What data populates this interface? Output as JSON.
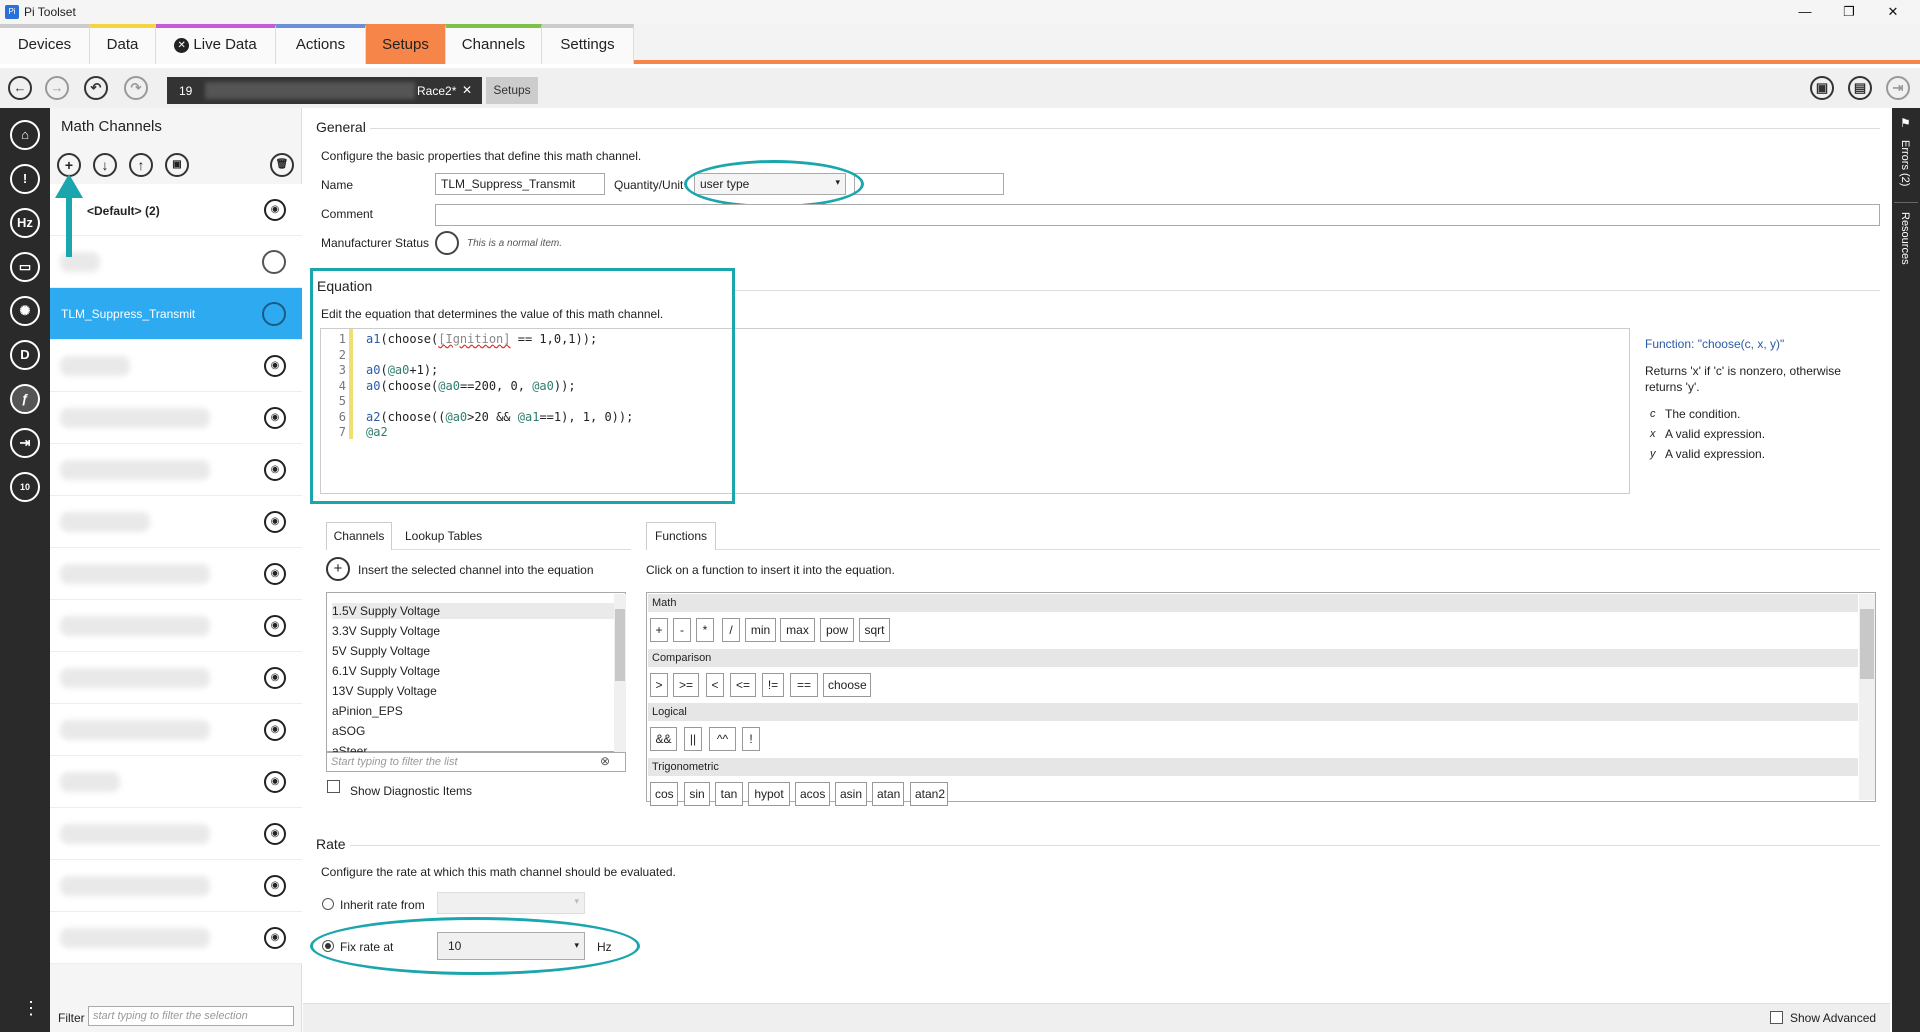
{
  "window": {
    "title": "Pi Toolset",
    "app_icon": "Pi",
    "minimize": "—",
    "maximize": "❐",
    "close": "✕"
  },
  "tabs": [
    {
      "label": "Devices",
      "color": "#cccccc"
    },
    {
      "label": "Data",
      "color": "#f5d442"
    },
    {
      "label": "Live Data",
      "color": "#c55bd8"
    },
    {
      "label": "Actions",
      "color": "#6a8fd8"
    },
    {
      "label": "Setups",
      "color": "#f58549"
    },
    {
      "label": "Channels",
      "color": "#7cc24a"
    },
    {
      "label": "Settings",
      "color": "#cccccc"
    }
  ],
  "live_data_icon": "close-circle-icon",
  "doc_tab": {
    "prefix": "19",
    "suffix": "Race2*",
    "close": "✕"
  },
  "setups_tab": "Setups",
  "list_panel": {
    "title": "Math Channels",
    "default_item": "<Default> (2)",
    "selected_item": "TLM_Suppress_Transmit",
    "filter_label": "Filter",
    "filter_placeholder": "start typing to filter the selection"
  },
  "general": {
    "title": "General",
    "description": "Configure the basic properties that define this math channel.",
    "name_label": "Name",
    "name_value": "TLM_Suppress_Transmit",
    "quantity_label": "Quantity/Unit",
    "quantity_value": "user type",
    "comment_label": "Comment",
    "manufacturer_label": "Manufacturer Status",
    "manufacturer_note": "This is a normal item."
  },
  "equation": {
    "title": "Equation",
    "description": "Edit the equation that determines the value of this math channel.",
    "line_numbers": [
      "1",
      "2",
      "3",
      "4",
      "5",
      "6",
      "7"
    ]
  },
  "help": {
    "title": "Function: \"choose(c, x, y)\"",
    "desc1": "Returns 'x' if 'c' is nonzero, otherwise",
    "desc2": "returns 'y'.",
    "params": [
      {
        "name": "c",
        "desc": "The condition."
      },
      {
        "name": "x",
        "desc": "A valid expression."
      },
      {
        "name": "y",
        "desc": "A valid expression."
      }
    ]
  },
  "channels_tabs": {
    "channels": "Channels",
    "lookup": "Lookup Tables",
    "functions": "Functions"
  },
  "insert_channel": "Insert the selected channel into the equation",
  "insert_function": "Click on a function to insert it into the equation.",
  "channel_list": [
    "1.5V Supply Voltage",
    "3.3V Supply Voltage",
    "5V Supply Voltage",
    "6.1V Supply Voltage",
    "13V Supply Voltage",
    "aPinion_EPS",
    "aSOG",
    "aSteer"
  ],
  "channel_filter_placeholder": "Start typing to filter the list",
  "show_diagnostic": "Show Diagnostic Items",
  "function_groups": {
    "math": {
      "label": "Math",
      "items": [
        "+",
        "-",
        "*",
        "/",
        "min",
        "max",
        "pow",
        "sqrt"
      ]
    },
    "comparison": {
      "label": "Comparison",
      "items": [
        ">",
        ">=",
        "<",
        "<=",
        "!=",
        "==",
        "choose"
      ]
    },
    "logical": {
      "label": "Logical",
      "items": [
        "&&",
        "||",
        "^^",
        "!"
      ]
    },
    "trig": {
      "label": "Trigonometric",
      "items": [
        "cos",
        "sin",
        "tan",
        "hypot",
        "acos",
        "asin",
        "atan",
        "atan2"
      ]
    }
  },
  "rate": {
    "title": "Rate",
    "description": "Configure the rate at which this math channel should be evaluated.",
    "inherit_label": "Inherit rate from",
    "fix_label": "Fix rate at",
    "fix_value": "10",
    "unit": "Hz"
  },
  "show_advanced": "Show Advanced",
  "right_rail": {
    "errors": "Errors (2)",
    "resources": "Resources"
  },
  "accent": "#1aa6ac",
  "select_blue": "#2eaaf0"
}
